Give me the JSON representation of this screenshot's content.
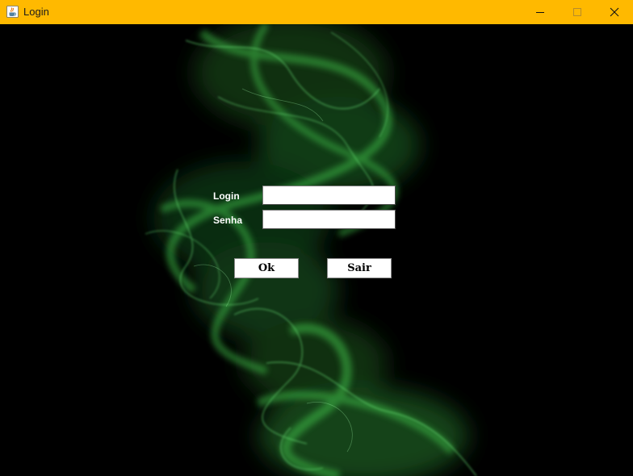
{
  "window": {
    "title": "Login",
    "title_bar_color": "#ffb900",
    "app_icon": "java-cup-icon",
    "controls": {
      "minimize_icon": "minimize-icon",
      "maximize_icon": "maximize-icon",
      "close_icon": "close-icon"
    }
  },
  "background": {
    "description_icon": "green-smoke-background",
    "accent_color": "#3fbf4a"
  },
  "form": {
    "login_label": "Login",
    "login_value": "",
    "senha_label": "Senha",
    "senha_value": "",
    "ok_button": "Ok",
    "sair_button": "Sair"
  }
}
